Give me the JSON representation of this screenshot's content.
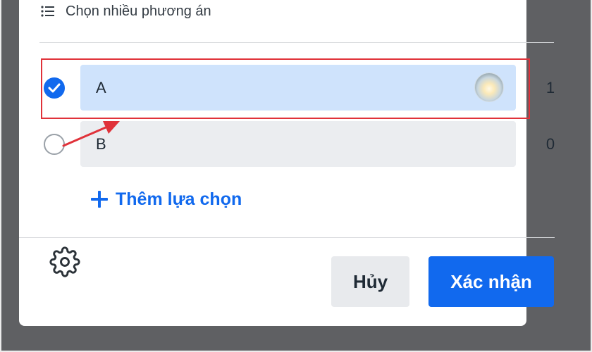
{
  "header": {
    "icon": "list-icon",
    "title": "Chọn nhiều phương án"
  },
  "options": [
    {
      "label": "A",
      "votes": "1",
      "selected": true,
      "voter_avatar": "avatar"
    },
    {
      "label": "B",
      "votes": "0",
      "selected": false
    }
  ],
  "add_option_label": "Thêm lựa chọn",
  "footer": {
    "settings_icon": "gear-icon",
    "cancel_label": "Hủy",
    "confirm_label": "Xác nhận"
  },
  "colors": {
    "accent": "#1169ee",
    "selected_option_bg": "#cfe3fc",
    "option_bg": "#ebedf0",
    "annotation": "#e0323a",
    "backdrop": "#5f6063"
  }
}
